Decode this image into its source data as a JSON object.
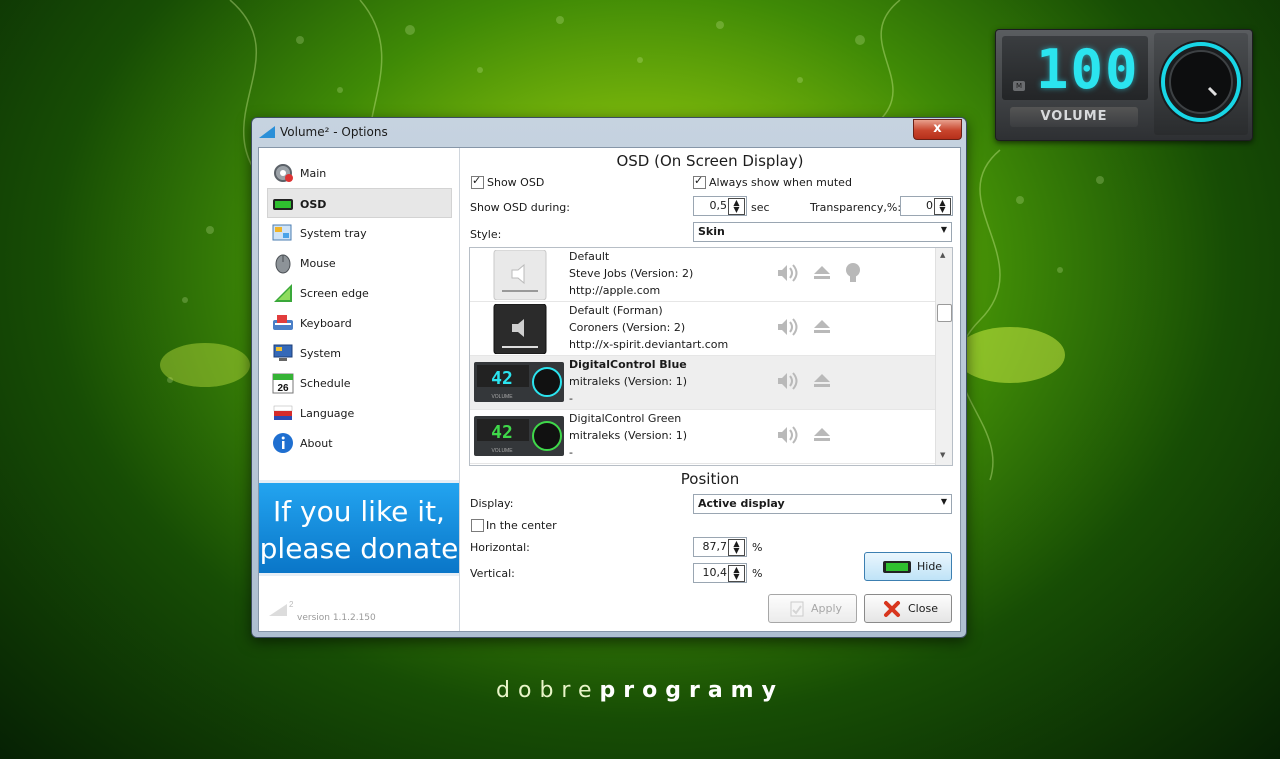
{
  "osd_widget": {
    "value": "100",
    "label": "VOLUME",
    "mute_label": "M"
  },
  "window": {
    "title": "Volume² - Options",
    "close_glyph": "x"
  },
  "sidebar": {
    "items": [
      {
        "label": "Main",
        "icon": "gear-icon"
      },
      {
        "label": "OSD",
        "icon": "osd-icon"
      },
      {
        "label": "System tray",
        "icon": "system-tray-icon"
      },
      {
        "label": "Mouse",
        "icon": "mouse-icon"
      },
      {
        "label": "Screen edge",
        "icon": "screen-edge-icon"
      },
      {
        "label": "Keyboard",
        "icon": "keyboard-icon"
      },
      {
        "label": "System",
        "icon": "system-icon"
      },
      {
        "label": "Schedule",
        "icon": "calendar-icon"
      },
      {
        "label": "Language",
        "icon": "flag-icon"
      },
      {
        "label": "About",
        "icon": "info-icon"
      }
    ],
    "selected": "OSD",
    "donate_line1": "If you like it,",
    "donate_line2": "please donate",
    "logo_sup": "2",
    "version": "version 1.1.2.150",
    "schedule_day": "26"
  },
  "osd": {
    "title": "OSD (On Screen Display)",
    "show_osd_label": "Show OSD",
    "show_osd_checked": true,
    "always_show_muted_label": "Always show when muted",
    "always_show_muted_checked": true,
    "show_during_label": "Show OSD during:",
    "show_during_value": "0,5",
    "show_during_unit": "sec",
    "transparency_label": "Transparency,%:",
    "transparency_value": "0",
    "style_label": "Style:",
    "style_value": "Skin"
  },
  "skins": [
    {
      "name": "Default",
      "author": "Steve Jobs (Version: 2)",
      "url": "http://apple.com",
      "selected": false
    },
    {
      "name": "Default (Forman)",
      "author": "Coroners (Version: 2)",
      "url": "http://x-spirit.deviantart.com",
      "selected": false
    },
    {
      "name": "DigitalControl Blue",
      "author": "mitraleks (Version: 1)",
      "url": "-",
      "selected": true,
      "digits": "42"
    },
    {
      "name": "DigitalControl Green",
      "author": "mitraleks (Version: 1)",
      "url": "-",
      "selected": false,
      "digits": "42"
    }
  ],
  "thumb_volume_label": "VOLUME",
  "position": {
    "title": "Position",
    "display_label": "Display:",
    "display_value": "Active display",
    "center_label": "In the center",
    "center_checked": false,
    "horizontal_label": "Horizontal:",
    "horizontal_value": "87,7",
    "vertical_label": "Vertical:",
    "vertical_value": "10,4",
    "percent": "%"
  },
  "buttons": {
    "hide": "Hide",
    "apply": "Apply",
    "close": "Close"
  },
  "brand": {
    "light": "dobre",
    "bold": "programy"
  },
  "colors": {
    "accent": "#2be4ef",
    "donate": "#1a8fe0",
    "osd_green": "#1f9a17"
  }
}
